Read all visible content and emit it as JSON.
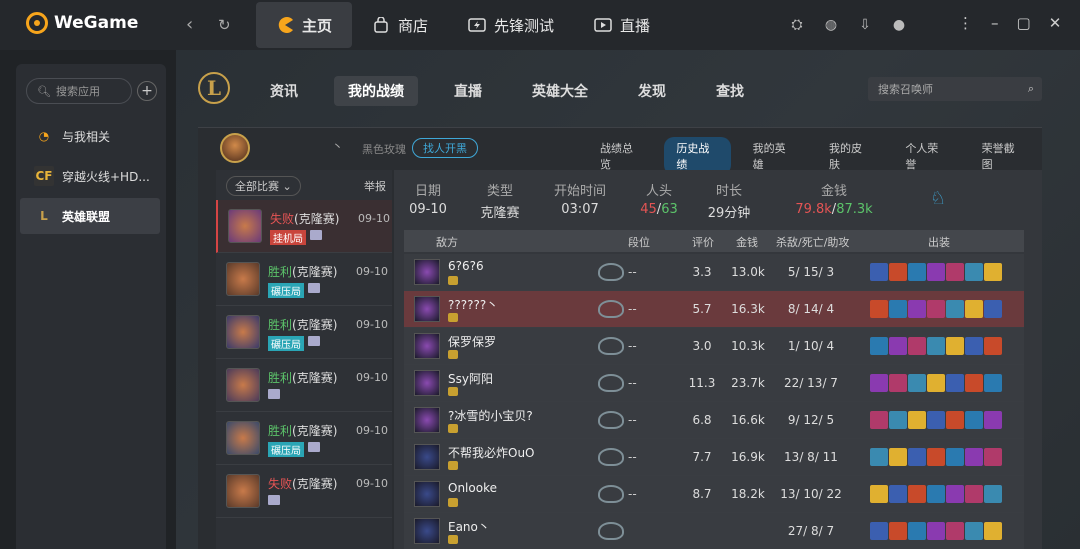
{
  "app": {
    "name": "WeGame"
  },
  "topnav": {
    "back": "‹",
    "refresh": "↻",
    "tabs": [
      {
        "label": "主页",
        "active": true
      },
      {
        "label": "商店"
      },
      {
        "label": "先锋测试"
      },
      {
        "label": "直播"
      }
    ]
  },
  "sidebar": {
    "search_placeholder": "搜索应用",
    "add": "+",
    "items": [
      {
        "label": "与我相关"
      },
      {
        "label": "穿越火线+HD..."
      },
      {
        "label": "英雄联盟",
        "active": true
      }
    ]
  },
  "lol": {
    "logo_letter": "L",
    "nav": [
      {
        "label": "资讯"
      },
      {
        "label": "我的战绩",
        "active": true
      },
      {
        "label": "直播"
      },
      {
        "label": "英雄大全"
      },
      {
        "label": "发现"
      },
      {
        "label": "查找"
      }
    ],
    "summoner_search_placeholder": "搜索召唤师"
  },
  "profile": {
    "name": "丶",
    "server": "黑色玫瑰",
    "find_team": "找人开黑",
    "subtabs": [
      {
        "label": "战绩总览"
      },
      {
        "label": "历史战绩",
        "active": true
      },
      {
        "label": "我的英雄"
      },
      {
        "label": "我的皮肤"
      },
      {
        "label": "个人荣誉"
      },
      {
        "label": "荣誉截图"
      }
    ]
  },
  "history": {
    "filter": "全部比赛",
    "report": "举报",
    "rows": [
      {
        "result": "失败",
        "mode": "(克隆赛)",
        "date": "09-10",
        "tag": "挂机局",
        "tag_color": "red",
        "outcome": "lose"
      },
      {
        "result": "胜利",
        "mode": "(克隆赛)",
        "date": "09-10",
        "tag": "碾压局",
        "tag_color": "cyan",
        "outcome": "win"
      },
      {
        "result": "胜利",
        "mode": "(克隆赛)",
        "date": "09-10",
        "tag": "碾压局",
        "tag_color": "cyan",
        "outcome": "win"
      },
      {
        "result": "胜利",
        "mode": "(克隆赛)",
        "date": "09-10",
        "tag": "",
        "outcome": "win"
      },
      {
        "result": "胜利",
        "mode": "(克隆赛)",
        "date": "09-10",
        "tag": "碾压局",
        "tag_color": "cyan",
        "outcome": "win"
      },
      {
        "result": "失败",
        "mode": "(克隆赛)",
        "date": "09-10",
        "tag": "",
        "outcome": "lose"
      }
    ]
  },
  "match": {
    "summary": [
      {
        "k": "日期",
        "v": "09-10"
      },
      {
        "k": "类型",
        "v": "克隆赛"
      },
      {
        "k": "开始时间",
        "v": "03:07"
      },
      {
        "k": "人头",
        "v1": "45",
        "sep": "/",
        "v2": "63"
      },
      {
        "k": "时长",
        "v": "29分钟"
      },
      {
        "k": "金钱",
        "v1": "79.8k",
        "sep": "/",
        "v2": "87.3k"
      }
    ],
    "headers": {
      "team": "敌方",
      "rank": "段位",
      "rating": "评价",
      "gold": "金钱",
      "kda": "杀敌/死亡/助攻",
      "items": "出装"
    },
    "players": [
      {
        "name": "6?6?6",
        "rank": "--",
        "rating": "3.3",
        "gold": "13.0k",
        "kda": "5/ 15/ 3"
      },
      {
        "name": "??????丶",
        "rank": "--",
        "rating": "5.7",
        "gold": "16.3k",
        "kda": "8/ 14/ 4",
        "selected": true
      },
      {
        "name": "保罗保罗",
        "rank": "--",
        "rating": "3.0",
        "gold": "10.3k",
        "kda": "1/ 10/ 4"
      },
      {
        "name": "Ssy阿阳",
        "rank": "--",
        "rating": "11.3",
        "gold": "23.7k",
        "kda": "22/ 13/ 7"
      },
      {
        "name": "?冰雪的小宝贝?",
        "rank": "--",
        "rating": "6.8",
        "gold": "16.6k",
        "kda": "9/ 12/ 5"
      },
      {
        "name": "不帮我必炸OuO",
        "rank": "--",
        "rating": "7.7",
        "gold": "16.9k",
        "kda": "13/ 8/ 11"
      },
      {
        "name": "Onlooke",
        "rank": "--",
        "rating": "8.7",
        "gold": "18.2k",
        "kda": "13/ 10/ 22"
      },
      {
        "name": "Eano丶",
        "rank": "",
        "rating": "",
        "gold": "",
        "kda": "27/ 8/ 7"
      }
    ]
  }
}
